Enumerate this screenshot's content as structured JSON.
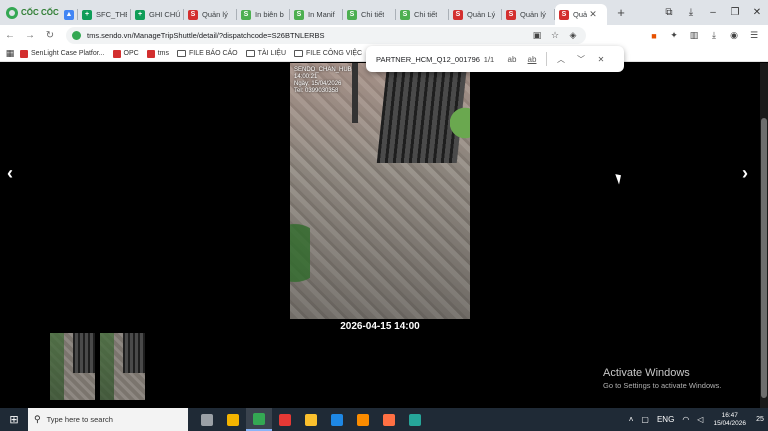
{
  "browser": {
    "brand_name": "CỐC CỐC",
    "tabs": [
      {
        "label": "",
        "color": "#4285f4",
        "glyph": "▲",
        "small": true
      },
      {
        "label": "SFC_THE",
        "color": "#0f9d58",
        "glyph": "+"
      },
      {
        "label": "GHI CHÚ",
        "color": "#0f9d58",
        "glyph": "+"
      },
      {
        "label": "Quản lý",
        "color": "#d32f2f",
        "glyph": "S"
      },
      {
        "label": "In biên b",
        "color": "#4caf50",
        "glyph": "S"
      },
      {
        "label": "In Manif",
        "color": "#4caf50",
        "glyph": "S"
      },
      {
        "label": "Chi tiết",
        "color": "#4caf50",
        "glyph": "S"
      },
      {
        "label": "Chi tiết",
        "color": "#4caf50",
        "glyph": "S"
      },
      {
        "label": "Quản Lý",
        "color": "#d32f2f",
        "glyph": "S"
      },
      {
        "label": "Quản lý",
        "color": "#d32f2f",
        "glyph": "S"
      },
      {
        "label": "Quả",
        "color": "#d32f2f",
        "glyph": "S",
        "active": true
      }
    ],
    "url": "tms.sendo.vn/ManageTripShuttle/detail/?dispatchcode=S26BTNLERBS",
    "bookmarks": [
      {
        "label": "SenLight Case Platfor...",
        "type": "site",
        "color": "#d32f2f"
      },
      {
        "label": "OPC",
        "type": "site",
        "color": "#d32f2f"
      },
      {
        "label": "tms",
        "type": "site",
        "color": "#d32f2f"
      },
      {
        "label": "FILE BÁO CÁO",
        "type": "folder"
      },
      {
        "label": "TÀI LIỆU",
        "type": "folder"
      },
      {
        "label": "FILE CÔNG VIỆC",
        "type": "folder"
      }
    ]
  },
  "find": {
    "query": "PARTNER_HCM_Q12_001796",
    "count": "1/1",
    "match_case": "ab",
    "whole_word": "ab"
  },
  "viewer": {
    "prev_arrow": "‹",
    "next_arrow": "›",
    "photo_stamp": [
      "SENDO_CHAN_HUB",
      "14:00:21",
      "Ngày: 15/04/2026",
      "Tel: 0399030358"
    ],
    "caption": "2026-04-15 14:00"
  },
  "watermark": {
    "title": "Activate Windows",
    "subtitle": "Go to Settings to activate Windows."
  },
  "taskbar": {
    "search_placeholder": "Type here to search",
    "apps": [
      {
        "name": "task-view",
        "color": "#9aa0a6"
      },
      {
        "name": "file-explorer",
        "color": "#f4b400"
      },
      {
        "name": "coccoc",
        "color": "#34a853",
        "active": true
      },
      {
        "name": "wps",
        "color": "#e53935"
      },
      {
        "name": "sticky-notes",
        "color": "#fbc02d"
      },
      {
        "name": "zalo",
        "color": "#1e88e5"
      },
      {
        "name": "chrome",
        "color": "#fb8c00"
      },
      {
        "name": "firefox",
        "color": "#ff7043"
      },
      {
        "name": "app",
        "color": "#26a69a"
      }
    ],
    "tray_lang": "ENG",
    "time": "16:47",
    "date": "15/04/2026",
    "notifications": "25"
  }
}
